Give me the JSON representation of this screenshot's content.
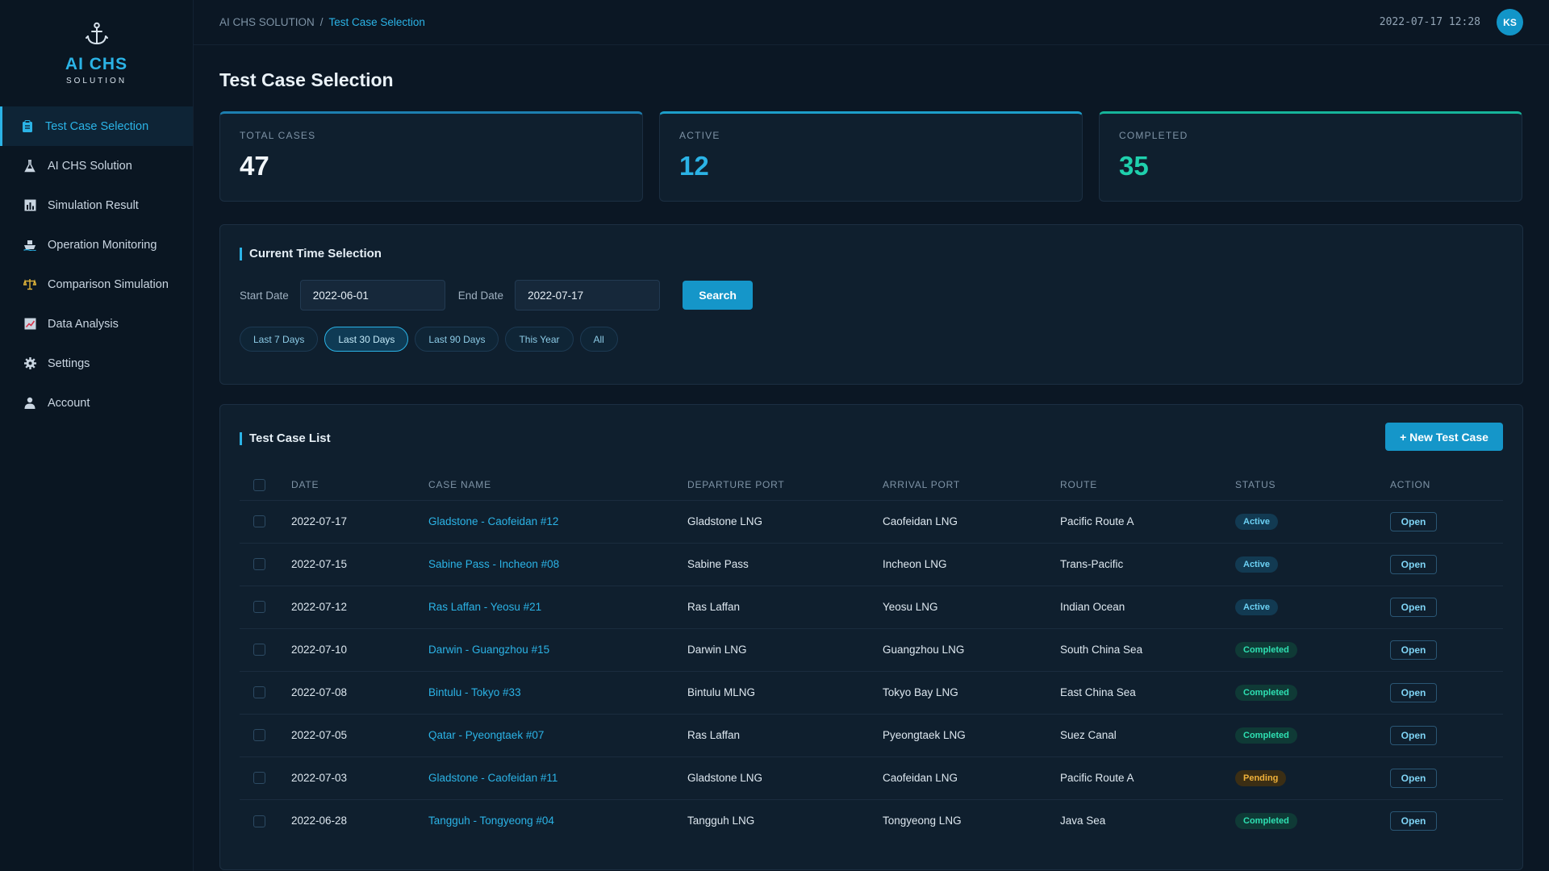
{
  "app": {
    "brand": "AI CHS",
    "brand_sub": "SOLUTION"
  },
  "sidebar": {
    "items": [
      {
        "label": "Test Case Selection",
        "icon": "clipboard-icon",
        "active": true
      },
      {
        "label": "AI CHS Solution",
        "icon": "flask-icon"
      },
      {
        "label": "Simulation Result",
        "icon": "bar-chart-icon"
      },
      {
        "label": "Operation Monitoring",
        "icon": "ship-icon"
      },
      {
        "label": "Comparison Simulation",
        "icon": "scale-icon"
      },
      {
        "label": "Data Analysis",
        "icon": "line-chart-icon"
      },
      {
        "label": "Settings",
        "icon": "gear-icon"
      },
      {
        "label": "Account",
        "icon": "user-icon"
      }
    ]
  },
  "header": {
    "breadcrumb_root": "AI CHS SOLUTION",
    "breadcrumb_sep": "/",
    "breadcrumb_current": "Test Case Selection",
    "datetime": "2022-07-17 12:28",
    "avatar_initials": "KS"
  },
  "page": {
    "title": "Test Case Selection"
  },
  "stats": {
    "total_label": "TOTAL CASES",
    "total_value": "47",
    "active_label": "ACTIVE",
    "active_value": "12",
    "completed_label": "COMPLETED",
    "completed_value": "35"
  },
  "time_selection": {
    "title": "Current Time Selection",
    "start_label": "Start Date",
    "start_value": "2022-06-01",
    "end_label": "End Date",
    "end_value": "2022-07-17",
    "search_label": "Search",
    "chips": [
      "Last 7 Days",
      "Last 30 Days",
      "Last 90 Days",
      "This Year",
      "All"
    ],
    "selected_chip": "Last 30 Days"
  },
  "list": {
    "title": "Test Case List",
    "new_button": "+ New Test Case",
    "columns": [
      "DATE",
      "CASE NAME",
      "DEPARTURE PORT",
      "ARRIVAL PORT",
      "ROUTE",
      "STATUS",
      "ACTION"
    ],
    "action_label": "Open",
    "rows": [
      {
        "date": "2022-07-17",
        "name": "Gladstone - Caofeidan #12",
        "dep": "Gladstone LNG",
        "arr": "Caofeidan LNG",
        "route": "Pacific Route A",
        "status": "Active"
      },
      {
        "date": "2022-07-15",
        "name": "Sabine Pass - Incheon #08",
        "dep": "Sabine Pass",
        "arr": "Incheon LNG",
        "route": "Trans-Pacific",
        "status": "Active"
      },
      {
        "date": "2022-07-12",
        "name": "Ras Laffan - Yeosu #21",
        "dep": "Ras Laffan",
        "arr": "Yeosu LNG",
        "route": "Indian Ocean",
        "status": "Active"
      },
      {
        "date": "2022-07-10",
        "name": "Darwin - Guangzhou #15",
        "dep": "Darwin LNG",
        "arr": "Guangzhou LNG",
        "route": "South China Sea",
        "status": "Completed"
      },
      {
        "date": "2022-07-08",
        "name": "Bintulu - Tokyo #33",
        "dep": "Bintulu MLNG",
        "arr": "Tokyo Bay LNG",
        "route": "East China Sea",
        "status": "Completed"
      },
      {
        "date": "2022-07-05",
        "name": "Qatar - Pyeongtaek #07",
        "dep": "Ras Laffan",
        "arr": "Pyeongtaek LNG",
        "route": "Suez Canal",
        "status": "Completed"
      },
      {
        "date": "2022-07-03",
        "name": "Gladstone - Caofeidan #11",
        "dep": "Gladstone LNG",
        "arr": "Caofeidan LNG",
        "route": "Pacific Route A",
        "status": "Pending"
      },
      {
        "date": "2022-06-28",
        "name": "Tangguh - Tongyeong #04",
        "dep": "Tangguh LNG",
        "arr": "Tongyeong LNG",
        "route": "Java Sea",
        "status": "Completed"
      }
    ]
  },
  "colors": {
    "accent": "#2bb3e6",
    "background": "#0b1724",
    "panel": "#0f1f2e",
    "active": "#6cd1f4",
    "completed": "#2ee0b2",
    "pending": "#f0b23a"
  }
}
